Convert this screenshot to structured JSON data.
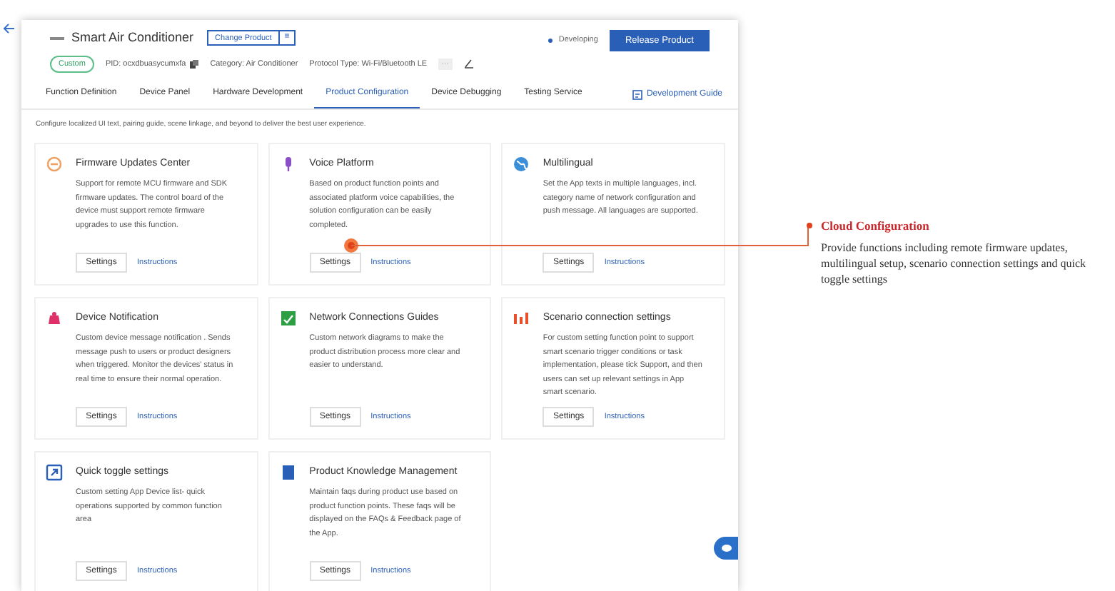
{
  "header": {
    "product_name": "Smart Air Conditioner",
    "change_button": "Change Product",
    "change_menu": "≡",
    "tag": "Custom",
    "pid": "PID: ocxdbuasycumxfa",
    "category": "Category: Air Conditioner",
    "protocol": "Protocol Type: Wi-Fi/Bluetooth LE",
    "more": "···",
    "status": "Developing",
    "release_button": "Release Product"
  },
  "tabs": [
    {
      "label": "Function Definition",
      "selected": false
    },
    {
      "label": "Device Panel",
      "selected": false
    },
    {
      "label": "Hardware Development",
      "selected": false
    },
    {
      "label": "Product Configuration",
      "selected": true
    },
    {
      "label": "Device Debugging",
      "selected": false
    },
    {
      "label": "Testing Service",
      "selected": false
    }
  ],
  "guide_link": "Development Guide",
  "description": "Configure localized UI text, pairing guide, scene linkage, and beyond to deliver the best user experience.",
  "cards": [
    {
      "kind": "firmware",
      "color": "#f0a060",
      "title": "Firmware Updates Center",
      "text": "Support for remote MCU firmware and SDK firmware updates. The control board of the device must support remote firmware upgrades to use this function.",
      "settings": "Settings",
      "instructions": "Instructions"
    },
    {
      "kind": "voice",
      "color": "#8a4fc8",
      "title": "Voice Platform",
      "text": "Based on product function points and associated platform voice capabilities, the solution configuration can be easily completed.",
      "settings": "Settings",
      "instructions": "Instructions"
    },
    {
      "kind": "globe",
      "color": "#3a8fd8",
      "title": "Multilingual",
      "text": "Set the App texts in multiple languages, incl. category name of network configuration and push message. All languages are supported.",
      "settings": "Settings",
      "instructions": "Instructions"
    },
    {
      "kind": "notification",
      "color": "#e0306a",
      "title": "Device Notification",
      "text": "Custom device message notification . Sends message push to users or product designers when triggered. Monitor the devices' status in real time to ensure their normal operation.",
      "settings": "Settings",
      "instructions": "Instructions"
    },
    {
      "kind": "network",
      "color": "#2e9e44",
      "title": "Network Connections Guides",
      "text": "Custom network diagrams to make the product distribution process more clear and easier to understand.",
      "settings": "Settings",
      "instructions": "Instructions"
    },
    {
      "kind": "scenario",
      "color": "#e8502a",
      "title": "Scenario connection settings",
      "text": "For custom setting function point to support smart scenario trigger conditions or task implementation, please tick Support, and then users can set up relevant settings in App smart scenario.",
      "settings": "Settings",
      "instructions": "Instructions"
    },
    {
      "kind": "toggle",
      "color": "#2a5fb8",
      "title": "Quick toggle settings",
      "text": "Custom setting App Device list- quick operations supported by common function area",
      "settings": "Settings",
      "instructions": "Instructions"
    },
    {
      "kind": "book",
      "color": "#2a5fb8",
      "title": "Product Knowledge Management",
      "text": "Maintain faqs during product use based on product function points. These faqs will be displayed on the FAQs & Feedback page of the App.",
      "settings": "Settings",
      "instructions": "Instructions"
    }
  ],
  "annotation": {
    "title": "Cloud Configuration",
    "text": "Provide functions including remote firmware updates, multilingual setup, scenario connection settings and quick toggle settings"
  }
}
